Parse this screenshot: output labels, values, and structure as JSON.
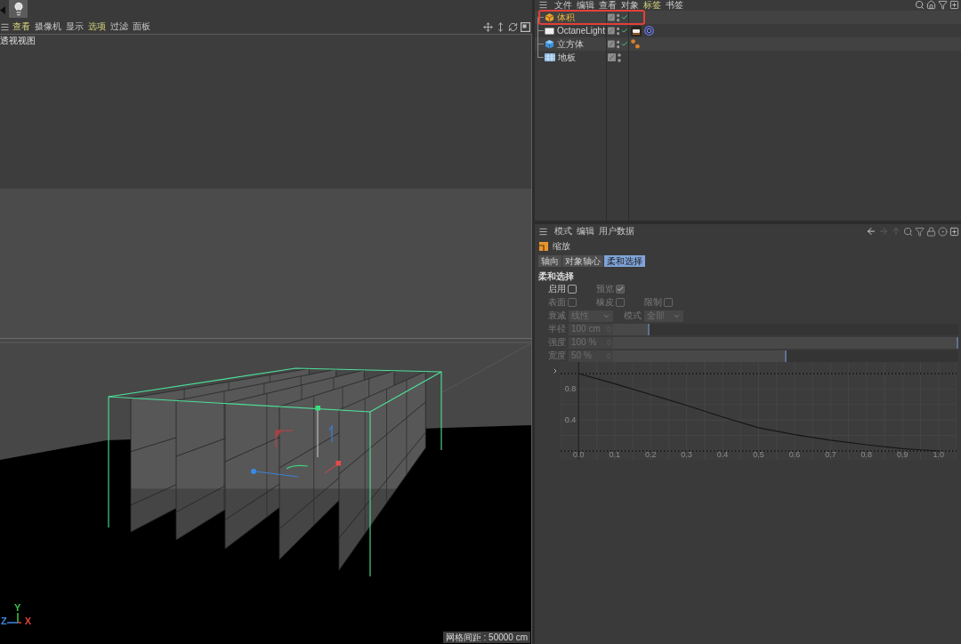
{
  "viewport": {
    "menu": [
      {
        "label": "查看",
        "highlighted": true
      },
      {
        "label": "摄像机",
        "highlighted": false
      },
      {
        "label": "显示",
        "highlighted": false
      },
      {
        "label": "选项",
        "highlighted": true
      },
      {
        "label": "过滤",
        "highlighted": false
      },
      {
        "label": "面板",
        "highlighted": false
      }
    ],
    "view_name": "透视视图",
    "axes": [
      {
        "label": "Y",
        "color": "#3cc24a"
      },
      {
        "label": "Z",
        "color": "#3d86e0"
      },
      {
        "label": "X",
        "color": "#e0413c"
      }
    ],
    "grid_spacing": "网格间距 : 50000 cm"
  },
  "object_manager": {
    "menu": [
      {
        "label": "文件",
        "highlighted": false
      },
      {
        "label": "编辑",
        "highlighted": false
      },
      {
        "label": "查看",
        "highlighted": false
      },
      {
        "label": "对象",
        "highlighted": false
      },
      {
        "label": "标签",
        "highlighted": true
      },
      {
        "label": "书签",
        "highlighted": false
      }
    ],
    "objects": [
      {
        "name": "体积",
        "kind": "volume",
        "selected": true,
        "annotated": true,
        "enabled": true
      },
      {
        "name": "OctaneLight",
        "kind": "light",
        "selected": false,
        "annotated": false,
        "enabled": true,
        "tags": [
          {
            "kind": "light"
          },
          {
            "kind": "target"
          }
        ]
      },
      {
        "name": "立方体",
        "kind": "cube",
        "selected": false,
        "annotated": false,
        "enabled": true,
        "tags": [
          {
            "kind": "dots"
          }
        ]
      },
      {
        "name": "地板",
        "kind": "floor",
        "selected": false,
        "annotated": false,
        "enabled": false
      }
    ]
  },
  "attributes": {
    "menu": [
      "模式",
      "编辑",
      "用户数据"
    ],
    "nav": [
      {
        "kind": "back",
        "disabled": false
      },
      {
        "kind": "forward",
        "disabled": true
      },
      {
        "kind": "up",
        "disabled": true
      }
    ],
    "object_name": "缩放",
    "tabs": [
      {
        "label": "轴向",
        "selected": false
      },
      {
        "label": "对象轴心",
        "selected": false
      },
      {
        "label": "柔和选择",
        "selected": true
      }
    ],
    "section": "柔和选择",
    "rows": [
      {
        "fields": [
          {
            "kind": "checkbox",
            "label": "启用",
            "checked": false,
            "disabled": false
          },
          {
            "kind": "checkbox",
            "label": "预览",
            "checked": true,
            "disabled": true
          }
        ]
      },
      {
        "fields": [
          {
            "kind": "checkbox",
            "label": "表面",
            "checked": false,
            "disabled": true
          },
          {
            "kind": "checkbox",
            "label": "橡皮",
            "checked": false,
            "disabled": true
          },
          {
            "kind": "checkbox",
            "label": "限制",
            "checked": false,
            "disabled": true
          }
        ]
      },
      {
        "fields": [
          {
            "kind": "dropdown",
            "label": "衰减",
            "value": "线性",
            "disabled": true
          },
          {
            "kind": "dropdown",
            "label": "模式",
            "value": "全部",
            "disabled": true
          }
        ]
      },
      {
        "fields": [
          {
            "kind": "slider",
            "label": "半径",
            "value": "100 cm",
            "level": 0.1,
            "disabled": true
          }
        ]
      },
      {
        "fields": [
          {
            "kind": "slider",
            "label": "强度",
            "value": "100 %",
            "level": 1,
            "disabled": true
          }
        ]
      },
      {
        "fields": [
          {
            "kind": "slider",
            "label": "宽度",
            "value": "50 %",
            "level": 0.5,
            "disabled": true
          }
        ]
      }
    ],
    "graph": {
      "chart_data": {
        "type": "line",
        "x": [
          0,
          0.1,
          0.2,
          0.3,
          0.4,
          0.5,
          0.6,
          0.7,
          0.8,
          0.9,
          1
        ],
        "values": [
          1,
          0.87,
          0.73,
          0.59,
          0.44,
          0.3,
          0.21,
          0.14,
          0.08,
          0.03,
          0
        ],
        "xlim": [
          -0.05,
          1.05
        ],
        "ylim": [
          0,
          1
        ],
        "xticks": [
          {
            "value": 0,
            "label": "0.0"
          },
          0.1,
          0.2,
          0.3,
          0.4,
          0.5,
          0.6,
          0.7,
          0.8,
          0.9,
          {
            "value": 1,
            "label": "1.0"
          }
        ],
        "yticks": [
          0.4,
          0.8
        ],
        "grid": true
      }
    }
  }
}
